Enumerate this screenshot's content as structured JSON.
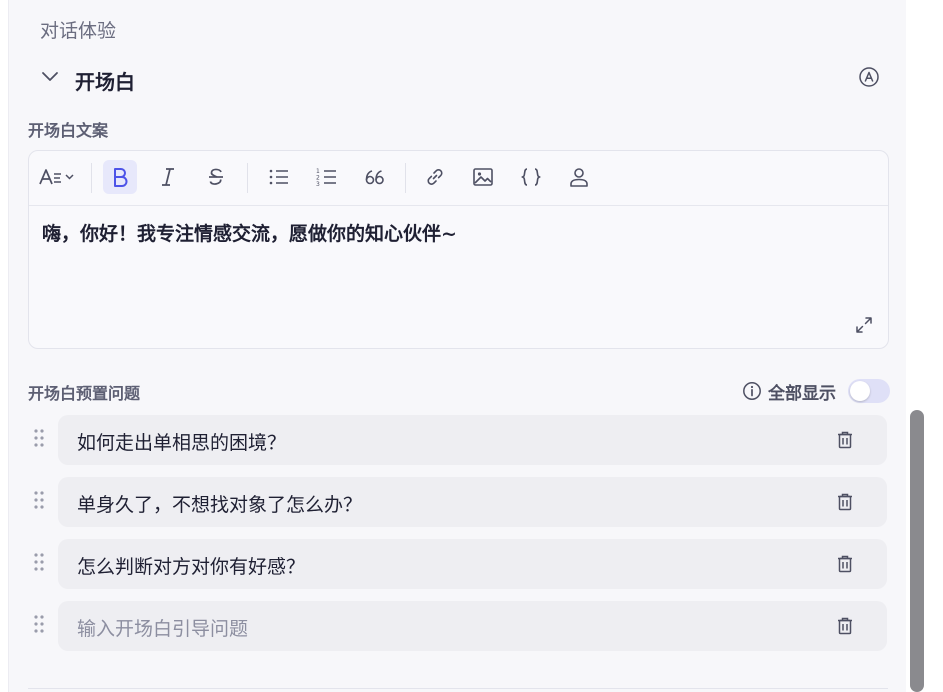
{
  "section": {
    "title": "对话体验"
  },
  "opening": {
    "title": "开场白",
    "icons": {
      "collapse": "chevron-down-icon",
      "auto": "circled-a-icon"
    }
  },
  "copy": {
    "label": "开场白文案",
    "text": "嗨，你好！我专注情感交流，愿做你的知心伙伴~",
    "toolbar": [
      "font-size",
      "bold",
      "italic",
      "strikethrough",
      "bullet-list",
      "numbered-list",
      "quote",
      "link",
      "image",
      "code",
      "user-variable"
    ]
  },
  "questions": {
    "label": "开场白预置问题",
    "show_all_label": "全部显示",
    "show_all_on": false,
    "items": [
      {
        "text": "如何走出单相思的困境？"
      },
      {
        "text": "单身久了，不想找对象了怎么办？"
      },
      {
        "text": "怎么判断对方对你有好感？"
      }
    ],
    "placeholder": "输入开场白引导问题"
  },
  "colors": {
    "accent": "#4d53e8",
    "panel_bg": "#f7f7fa",
    "row_bg": "#eeeef2"
  }
}
